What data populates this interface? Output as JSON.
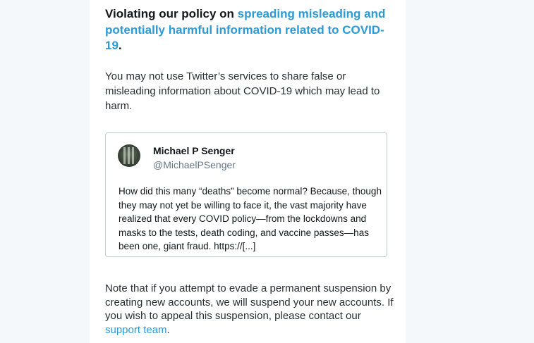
{
  "notice": {
    "heading_prefix": "Violating our policy on ",
    "heading_link": "spreading misleading and potentially harmful information related to COVID-19",
    "heading_suffix": ".",
    "intro": "You may not use Twitter’s services to share false or misleading information about COVID-19 which may lead to harm."
  },
  "tweet": {
    "author_name": "Michael P Senger",
    "author_handle": "@MichaelPSenger",
    "text": "How did this many “deaths” become normal? Because, though they may not yet be willing to face it, the vast majority have realized that every COVID policy—from the lockdowns and masks to the tests, death coding, and vaccine passes—has been one, giant fraud. https://[...]"
  },
  "footer": {
    "text_before_link": "Note that if you attempt to evade a permanent suspension by creating new accounts, we will suspend your new accounts. If you wish to appeal this suspension, please contact our ",
    "link_text": "support team",
    "text_after_link": "."
  },
  "colors": {
    "link": "#2b9ad6",
    "background": "#f5f8fa",
    "panel": "#ffffff"
  }
}
